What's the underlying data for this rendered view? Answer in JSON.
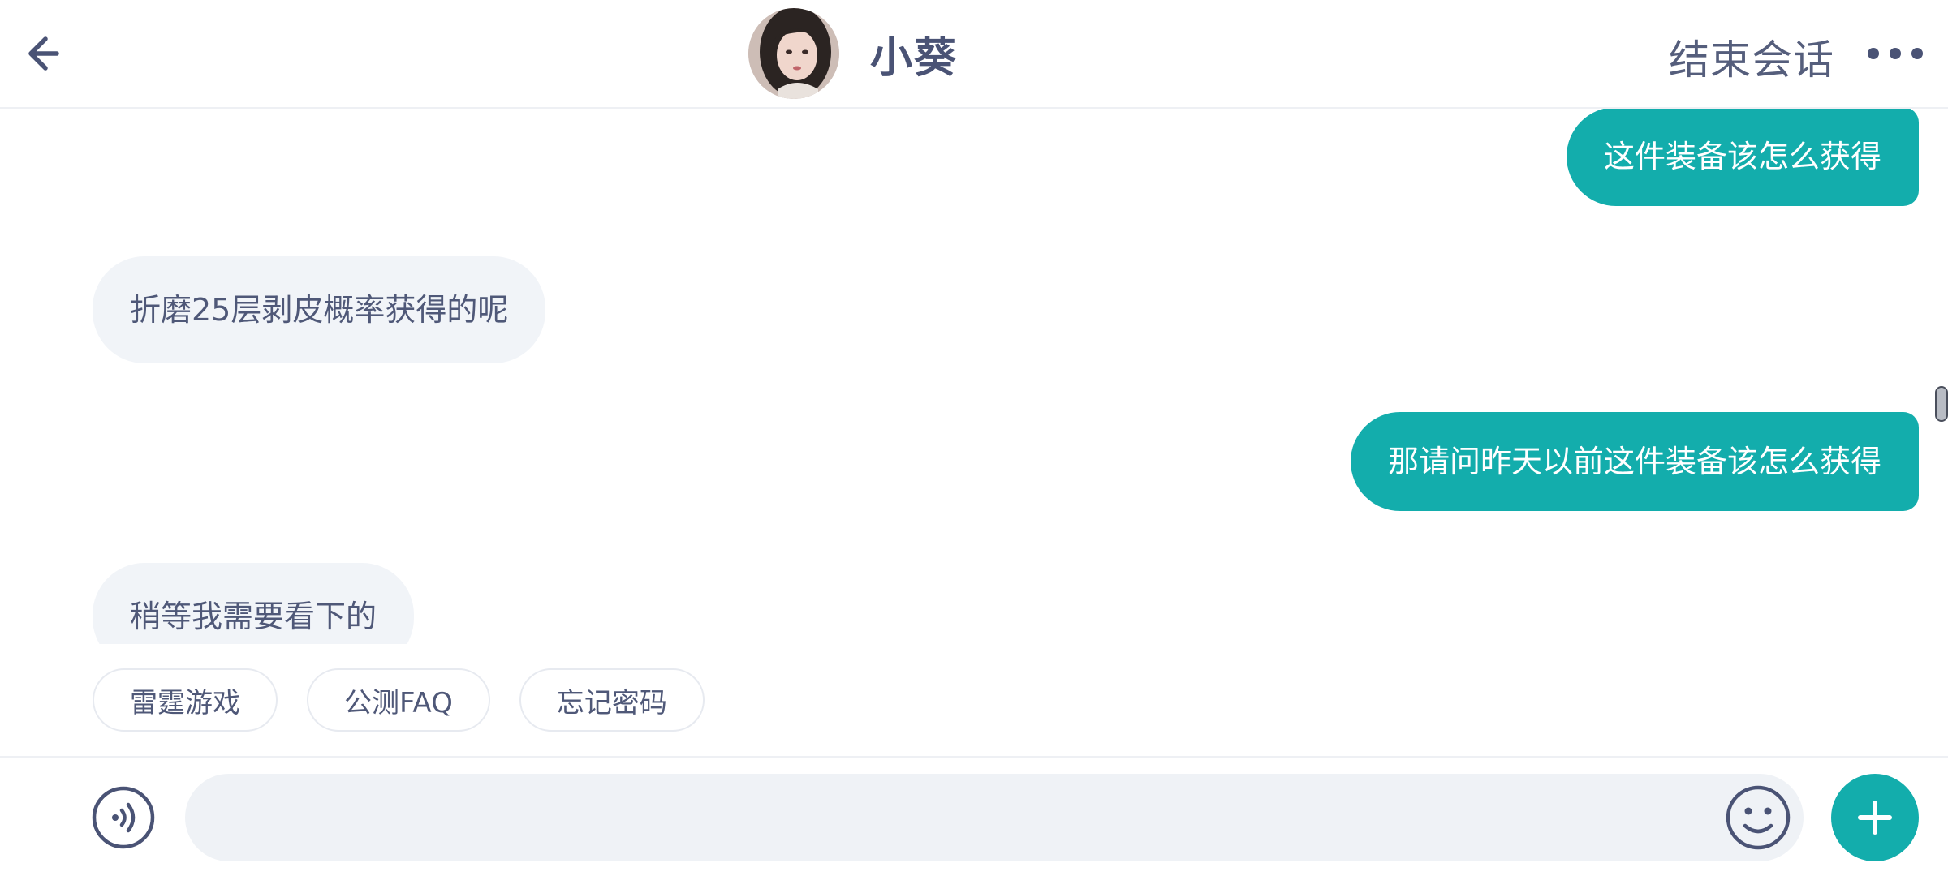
{
  "header": {
    "agent_name": "小葵",
    "end_session_label": "结束会话",
    "back_icon": "arrow-left-icon",
    "more_icon": "more-horizontal-icon"
  },
  "messages": [
    {
      "direction": "outgoing",
      "text": "这件装备该怎么获得"
    },
    {
      "direction": "incoming",
      "text": "折磨25层剥皮概率获得的呢"
    },
    {
      "direction": "outgoing",
      "text": "那请问昨天以前这件装备该怎么获得"
    },
    {
      "direction": "incoming",
      "text": "稍等我需要看下的"
    }
  ],
  "quick_replies": [
    {
      "label": "雷霆游戏"
    },
    {
      "label": "公测FAQ"
    },
    {
      "label": "忘记密码"
    }
  ],
  "input_bar": {
    "value": "",
    "placeholder": "",
    "voice_icon": "voice-icon",
    "emoji_icon": "emoji-icon",
    "plus_icon": "plus-icon"
  },
  "colors": {
    "accent": "#13adac",
    "text": "#4a5375",
    "incoming_bubble": "#f1f4f8",
    "input_bg": "#eff2f6"
  }
}
